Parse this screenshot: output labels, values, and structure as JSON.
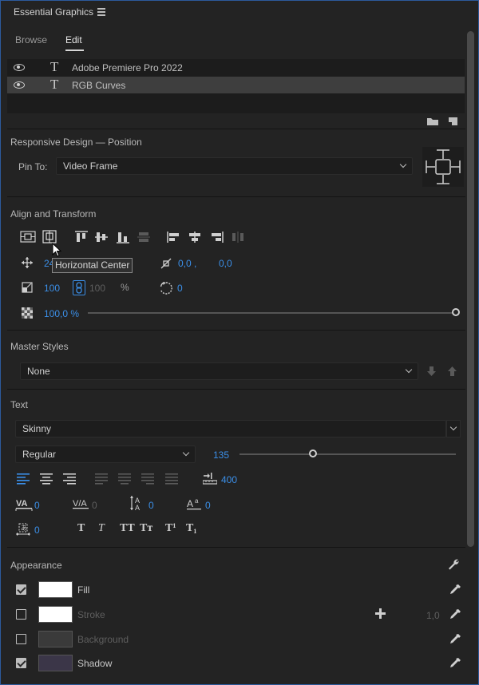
{
  "panel": {
    "title": "Essential Graphics"
  },
  "tabs": [
    {
      "label": "Browse"
    },
    {
      "label": "Edit"
    }
  ],
  "layers": [
    {
      "name": "Adobe Premiere Pro 2022",
      "selected": false
    },
    {
      "name": "RGB Curves",
      "selected": true
    }
  ],
  "responsive": {
    "section_label": "Responsive Design — Position",
    "pin_label": "Pin To:",
    "pin_value": "Video Frame"
  },
  "align": {
    "section_label": "Align and Transform",
    "position_x": "24",
    "tooltip": "Horizontal Center",
    "anchor_x": "0,0 ,",
    "anchor_y": "0,0",
    "scale": "100",
    "scale_h": "100",
    "scale_unit": "%",
    "rotation": "0",
    "opacity": "100,0 %",
    "opacity_fraction": 1.0
  },
  "master_styles": {
    "section_label": "Master Styles",
    "value": "None"
  },
  "text": {
    "section_label": "Text",
    "font": "Skinny",
    "style": "Regular",
    "size": "135",
    "size_fraction": 0.34,
    "tab_width": "400",
    "kerning": "0",
    "tracking": "0",
    "leading": "0",
    "baseline": "0",
    "tsume": "0",
    "format_buttons": [
      "T",
      "T",
      "TT",
      "Tт",
      "T¹",
      "T₁"
    ]
  },
  "appearance": {
    "section_label": "Appearance",
    "stroke_width": "1,0",
    "items": [
      {
        "label": "Fill",
        "checked": true,
        "color": "#ffffff"
      },
      {
        "label": "Stroke",
        "checked": false,
        "color": "#ffffff"
      },
      {
        "label": "Background",
        "checked": false,
        "color": "#3a3a3a"
      },
      {
        "label": "Shadow",
        "checked": true,
        "color": "#3b3648"
      }
    ]
  },
  "colors": {
    "accent": "#3b8fe8",
    "panel_bg": "#232323",
    "border": "#2c5a9c"
  }
}
